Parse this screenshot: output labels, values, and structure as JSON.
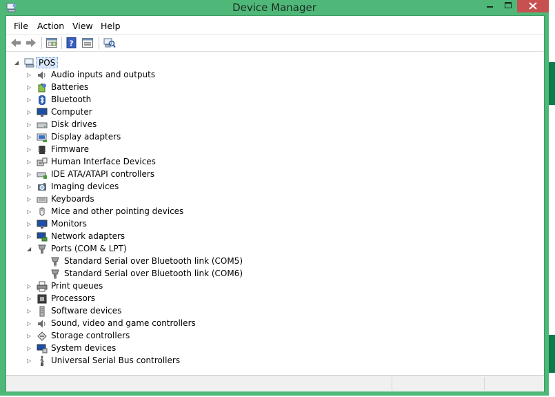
{
  "window": {
    "title": "Device Manager",
    "accent_color": "#4fb878",
    "close_color": "#c75050"
  },
  "menu": {
    "items": [
      "File",
      "Action",
      "View",
      "Help"
    ]
  },
  "toolbar": {
    "icons": [
      "back-arrow-icon",
      "forward-arrow-icon",
      "properties-icon",
      "help-icon",
      "console-tree-icon",
      "scan-hardware-icon"
    ]
  },
  "tree": {
    "root": {
      "label": "POS",
      "icon": "computer-icon",
      "expanded": true
    },
    "items": [
      {
        "label": "Audio inputs and outputs",
        "icon": "speaker-icon",
        "expanded": false
      },
      {
        "label": "Batteries",
        "icon": "battery-icon",
        "expanded": false
      },
      {
        "label": "Bluetooth",
        "icon": "bluetooth-icon",
        "expanded": false
      },
      {
        "label": "Computer",
        "icon": "monitor-icon",
        "expanded": false
      },
      {
        "label": "Disk drives",
        "icon": "disk-drive-icon",
        "expanded": false
      },
      {
        "label": "Display adapters",
        "icon": "display-adapter-icon",
        "expanded": false
      },
      {
        "label": "Firmware",
        "icon": "firmware-chip-icon",
        "expanded": false
      },
      {
        "label": "Human Interface Devices",
        "icon": "hid-icon",
        "expanded": false
      },
      {
        "label": "IDE ATA/ATAPI controllers",
        "icon": "ide-controller-icon",
        "expanded": false
      },
      {
        "label": "Imaging devices",
        "icon": "camera-icon",
        "expanded": false
      },
      {
        "label": "Keyboards",
        "icon": "keyboard-icon",
        "expanded": false
      },
      {
        "label": "Mice and other pointing devices",
        "icon": "mouse-icon",
        "expanded": false
      },
      {
        "label": "Monitors",
        "icon": "monitor-icon",
        "expanded": false
      },
      {
        "label": "Network adapters",
        "icon": "network-icon",
        "expanded": false
      },
      {
        "label": "Ports (COM & LPT)",
        "icon": "port-icon",
        "expanded": true
      },
      {
        "label": "Standard Serial over Bluetooth link (COM5)",
        "icon": "serial-port-icon",
        "child": true
      },
      {
        "label": "Standard Serial over Bluetooth link (COM6)",
        "icon": "serial-port-icon",
        "child": true
      },
      {
        "label": "Print queues",
        "icon": "printer-icon",
        "expanded": false
      },
      {
        "label": "Processors",
        "icon": "processor-icon",
        "expanded": false
      },
      {
        "label": "Software devices",
        "icon": "software-device-icon",
        "expanded": false
      },
      {
        "label": "Sound, video and game controllers",
        "icon": "speaker-icon",
        "expanded": false
      },
      {
        "label": "Storage controllers",
        "icon": "storage-icon",
        "expanded": false
      },
      {
        "label": "System devices",
        "icon": "system-devices-icon",
        "expanded": false
      },
      {
        "label": "Universal Serial Bus controllers",
        "icon": "usb-icon",
        "expanded": false
      }
    ]
  }
}
